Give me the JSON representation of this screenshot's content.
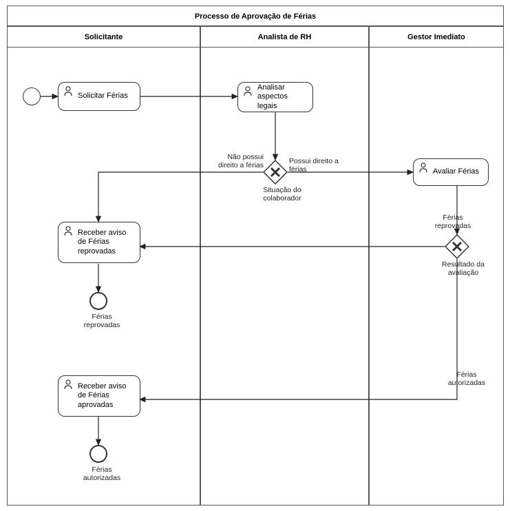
{
  "pool": {
    "title": "Processo de Aprovação de Férias"
  },
  "lanes": {
    "solicitante": "Solicitante",
    "analista": "Analista de RH",
    "gestor": "Gestor Imediato"
  },
  "tasks": {
    "solicitar": "Solicitar Férias",
    "analisar": "Analisar aspectos legais",
    "avaliar": "Avaliar Férias",
    "receberReprov": "Receber aviso de Férias reprovadas",
    "receberAprov": "Receber aviso de Férias aprovadas"
  },
  "gateways": {
    "situacao": "Situação do colaborador",
    "resultado": "Resultado da avaliação"
  },
  "flowLabels": {
    "naoPossui": "Não possui direito a férias",
    "possui": "Possui direito a férias",
    "reprovadas": "Férias reprovadas",
    "autorizadas": "Férias autorizadas"
  },
  "endEvents": {
    "reprovadas": "Férias reprovadas",
    "autorizadas": "Férias autorizadas"
  }
}
